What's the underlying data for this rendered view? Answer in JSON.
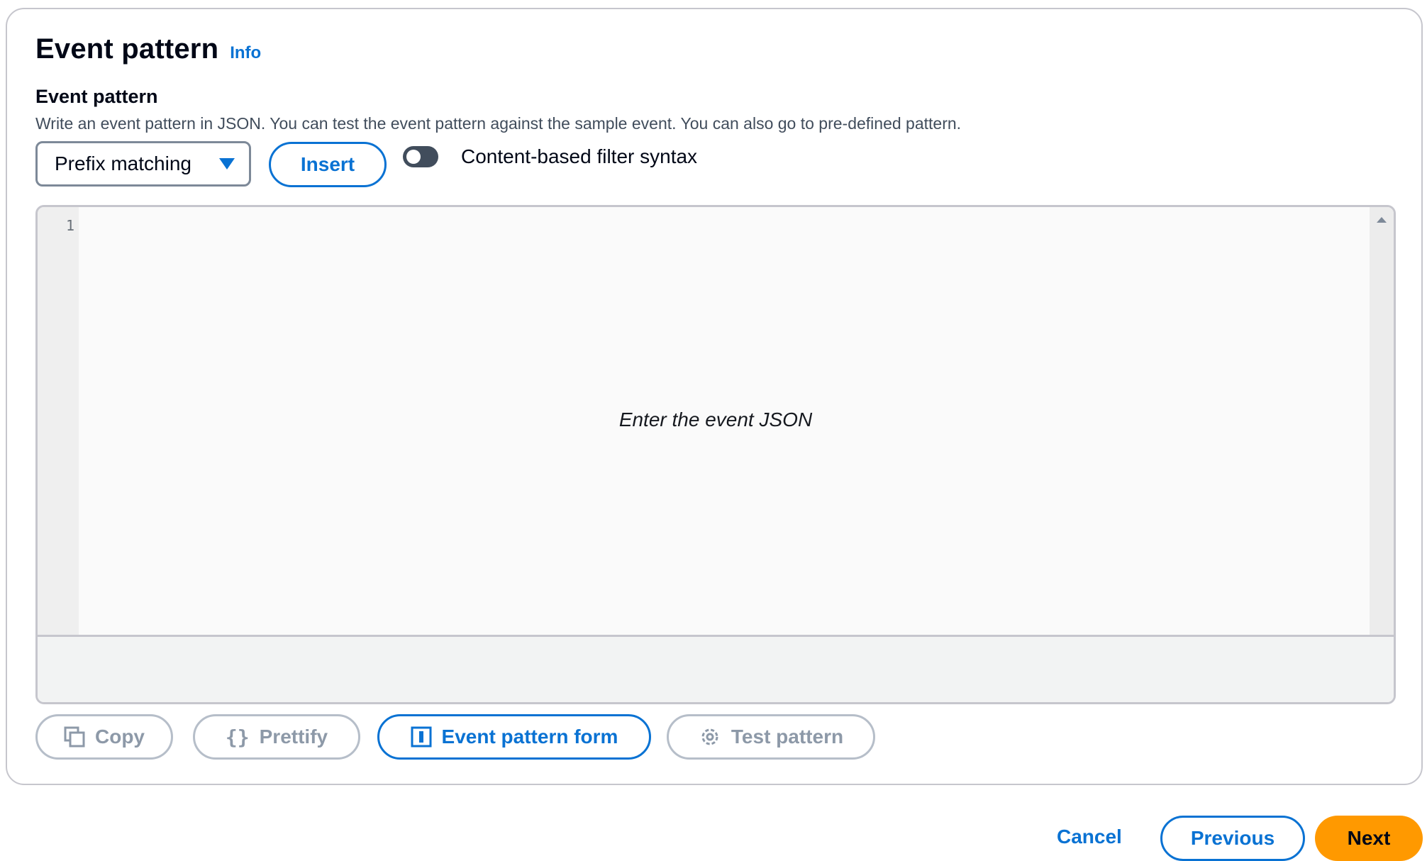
{
  "panel": {
    "title": "Event pattern",
    "info_link": "Info"
  },
  "field": {
    "label": "Event pattern",
    "description": "Write an event pattern in JSON. You can test the event pattern against the sample event. You can also go to pre-defined pattern."
  },
  "controls": {
    "select_value": "Prefix matching",
    "insert_label": "Insert",
    "toggle_label": "Content-based filter syntax",
    "toggle_on": false
  },
  "editor": {
    "line_number": "1",
    "placeholder": "Enter the event JSON"
  },
  "toolbar": {
    "copy": "Copy",
    "prettify": "Prettify",
    "event_pattern_form": "Event pattern form",
    "test_pattern": "Test pattern"
  },
  "footer": {
    "cancel": "Cancel",
    "previous": "Previous",
    "next": "Next"
  },
  "colors": {
    "accent": "#0972d3",
    "primary_button": "#ff9900",
    "disabled": "#8d99a8"
  }
}
